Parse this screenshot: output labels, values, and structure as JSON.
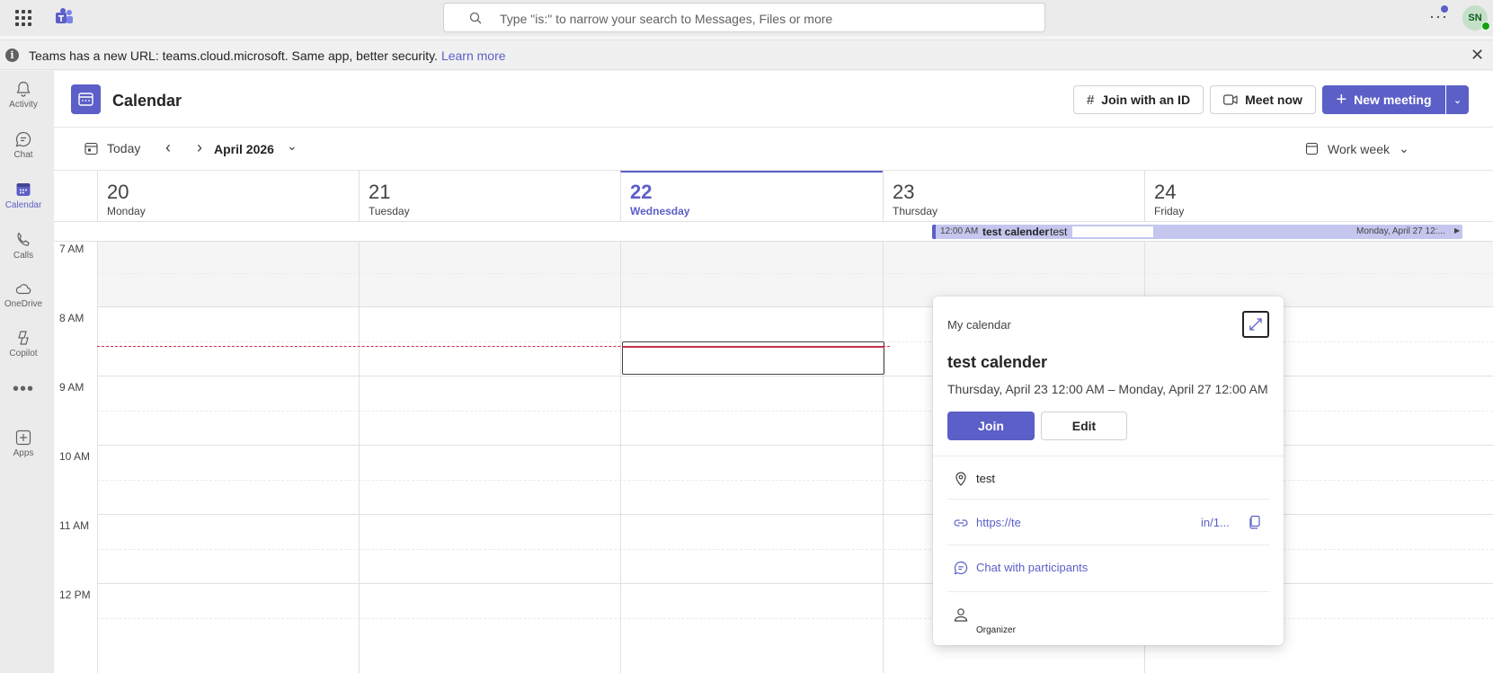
{
  "topbar": {
    "search_placeholder": "Type \"is:\" to narrow your search to Messages, Files or more",
    "more_label": "···",
    "avatar_initials": "SN"
  },
  "notice": {
    "text": "Teams has a new URL: teams.cloud.microsoft. Same app, better security.",
    "link": "Learn more",
    "info_glyph": "i",
    "close_glyph": "✕"
  },
  "rail": {
    "items": [
      {
        "label": "Activity",
        "icon": "bell-icon"
      },
      {
        "label": "Chat",
        "icon": "chat-icon"
      },
      {
        "label": "Calendar",
        "icon": "calendar-icon",
        "active": true
      },
      {
        "label": "Calls",
        "icon": "phone-icon"
      },
      {
        "label": "OneDrive",
        "icon": "cloud-icon"
      },
      {
        "label": "Copilot",
        "icon": "copilot-icon"
      },
      {
        "label": "Apps",
        "icon": "plus-square-icon"
      }
    ],
    "more": "•••"
  },
  "header": {
    "title": "Calendar",
    "join_with_id": "Join with an ID",
    "meet_now": "Meet now",
    "new_meeting": "New meeting",
    "new_meeting_chevron": "⌄"
  },
  "toolbar": {
    "today": "Today",
    "prev": "‹",
    "next": "›",
    "month": "April 2026",
    "month_chevron": "⌄",
    "view": "Work week",
    "view_chevron": "⌄"
  },
  "days": [
    {
      "num": "20",
      "name": "Monday"
    },
    {
      "num": "21",
      "name": "Tuesday"
    },
    {
      "num": "22",
      "name": "Wednesday",
      "today": true
    },
    {
      "num": "23",
      "name": "Thursday"
    },
    {
      "num": "24",
      "name": "Friday"
    }
  ],
  "allday_event": {
    "start": "12:00 AM",
    "title": "test calender",
    "location": "test",
    "end": "Monday, April 27 12:...",
    "arrow": "▶"
  },
  "times": [
    "7 AM",
    "8 AM",
    "9 AM",
    "10 AM",
    "11 AM",
    "12 PM"
  ],
  "popup": {
    "calendar": "My calendar",
    "title": "test calender",
    "range": "Thursday, April 23 12:00 AM – Monday, April 27 12:00 AM",
    "join": "Join",
    "edit": "Edit",
    "location": "test",
    "link_start": "https://te",
    "link_end": "in/1...",
    "chat": "Chat with participants",
    "organizer": "Organizer"
  },
  "colors": {
    "accent": "#5b5fc7",
    "now_line": "#c4314b",
    "event_fill": "#c5c6ee"
  }
}
